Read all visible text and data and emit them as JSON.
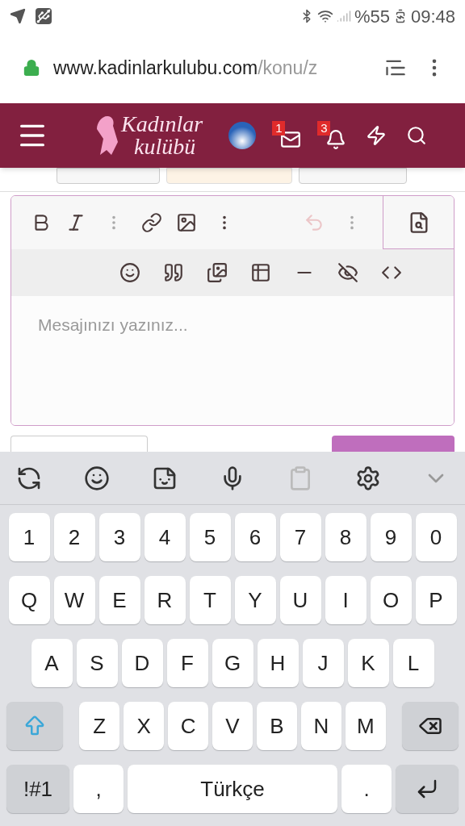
{
  "status_bar": {
    "battery": "%55",
    "time": "09:48"
  },
  "address_bar": {
    "domain": "www.kadinlarkulubu.com",
    "path": "/konu/z"
  },
  "header": {
    "logo_line_1": "Kadınlar",
    "logo_line_2": "kulübü",
    "badges": [
      {
        "kind": "mail",
        "count": "1"
      },
      {
        "kind": "bell",
        "count": "3"
      }
    ]
  },
  "editor": {
    "row_1": [
      {
        "kind": "bold",
        "disabled": false
      },
      {
        "kind": "italic",
        "disabled": false
      },
      {
        "kind": "more",
        "disabled": false
      },
      {
        "kind": "link",
        "disabled": false
      },
      {
        "kind": "image",
        "disabled": false
      },
      {
        "kind": "more",
        "disabled": false
      },
      {
        "kind": "undo",
        "disabled": true
      },
      {
        "kind": "more",
        "disabled": false
      }
    ],
    "row_2": [
      {
        "kind": "smile"
      },
      {
        "kind": "quote"
      },
      {
        "kind": "gallery"
      },
      {
        "kind": "table"
      },
      {
        "kind": "rule"
      },
      {
        "kind": "spoiler"
      },
      {
        "kind": "code"
      }
    ],
    "placeholder": "Mesajınızı yazınız..."
  },
  "keyboard": {
    "rows": [
      [
        "1",
        "2",
        "3",
        "4",
        "5",
        "6",
        "7",
        "8",
        "9",
        "0"
      ],
      [
        "Q",
        "W",
        "E",
        "R",
        "T",
        "Y",
        "U",
        "I",
        "O",
        "P"
      ],
      [
        "A",
        "S",
        "D",
        "F",
        "G",
        "H",
        "J",
        "K",
        "L"
      ],
      [
        "Z",
        "X",
        "C",
        "V",
        "B",
        "N",
        "M"
      ]
    ],
    "symbols": "!#1",
    "comma": ",",
    "space": "Türkçe",
    "period": "."
  }
}
